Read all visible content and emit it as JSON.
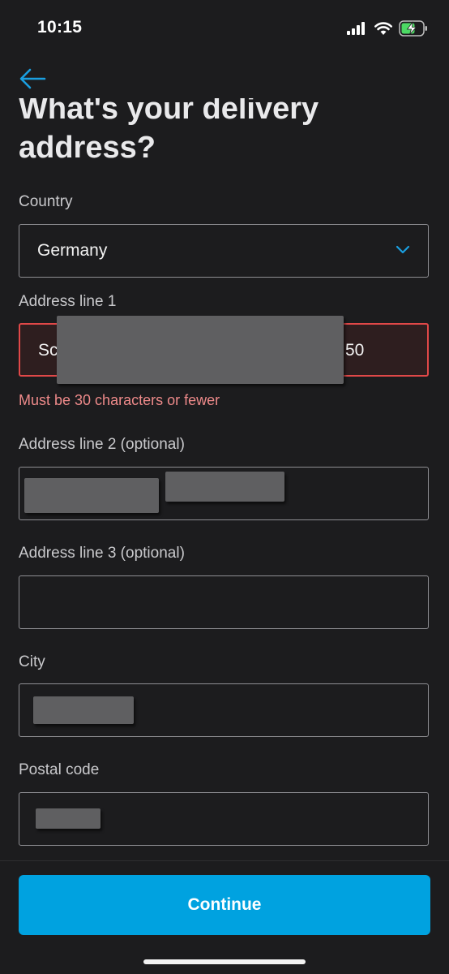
{
  "status_bar": {
    "time": "10:15",
    "icons": [
      "signal-icon",
      "wifi-icon",
      "battery-charging-icon"
    ]
  },
  "header": {
    "back_icon": "arrow-left-icon",
    "title": "What's your delivery address?"
  },
  "form": {
    "country": {
      "label": "Country",
      "value": "Germany",
      "icon": "chevron-down-icon"
    },
    "address_line_1": {
      "label": "Address line 1",
      "value_prefix": "Sc",
      "value_suffix": "50",
      "error": "Must be  30 characters or fewer"
    },
    "address_line_2": {
      "label": "Address line 2 (optional)"
    },
    "address_line_3": {
      "label": "Address line 3 (optional)",
      "value": ""
    },
    "city": {
      "label": "City"
    },
    "postal_code": {
      "label": "Postal code"
    }
  },
  "footer": {
    "continue_label": "Continue"
  },
  "colors": {
    "background": "#1c1c1e",
    "accent": "#00a2e0",
    "error": "#e04848",
    "error_text": "#ee8a8a"
  }
}
